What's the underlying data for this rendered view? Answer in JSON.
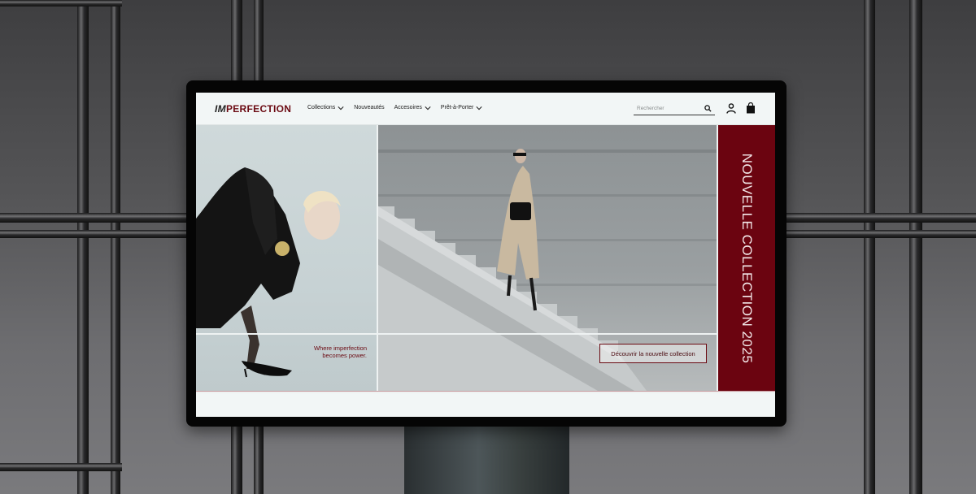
{
  "brand": {
    "prefix": "IM",
    "name": "PERFECTION"
  },
  "nav": {
    "items": [
      {
        "label": "Collections",
        "dropdown": true
      },
      {
        "label": "Nouveautés",
        "dropdown": false
      },
      {
        "label": "Accesoires",
        "dropdown": true
      },
      {
        "label": "Prêt-à-Porter",
        "dropdown": true
      }
    ]
  },
  "search": {
    "placeholder": "Rechercher",
    "value": ""
  },
  "icons": {
    "search": "search-icon",
    "account": "user-icon",
    "bag": "shopping-bag-icon",
    "chevron": "chevron-down-icon"
  },
  "hero": {
    "tagline_line1": "Where imperfection",
    "tagline_line2": "becomes power.",
    "cta_label": "Découvrir la nouvelle collection",
    "side_title": "NOUVELLE COLLECTION 2025"
  },
  "colors": {
    "accent": "#6b0410",
    "header_bg": "#f2f6f6",
    "text": "#1a1a1a"
  }
}
